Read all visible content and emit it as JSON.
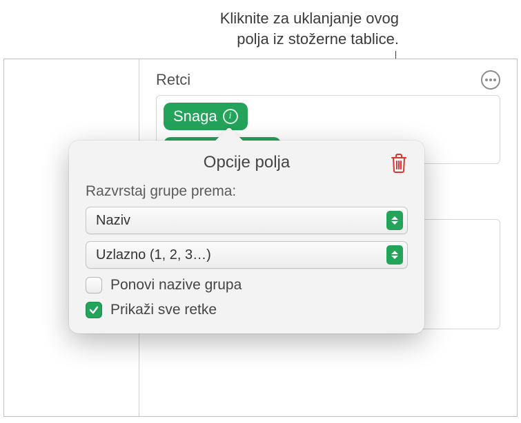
{
  "callout": {
    "line1": "Kliknite za uklanjanje ovog",
    "line2": "polja iz stožerne tablice."
  },
  "inspector": {
    "section_title": "Retci",
    "pill_label": "Snaga"
  },
  "popover": {
    "title": "Opcije polja",
    "sort_label": "Razvrstaj grupe prema:",
    "sort_by": "Naziv",
    "sort_order": "Uzlazno (1, 2, 3…)",
    "repeat_label": "Ponovi nazive grupa",
    "repeat_checked": false,
    "show_all_label": "Prikaži sve retke",
    "show_all_checked": true
  }
}
